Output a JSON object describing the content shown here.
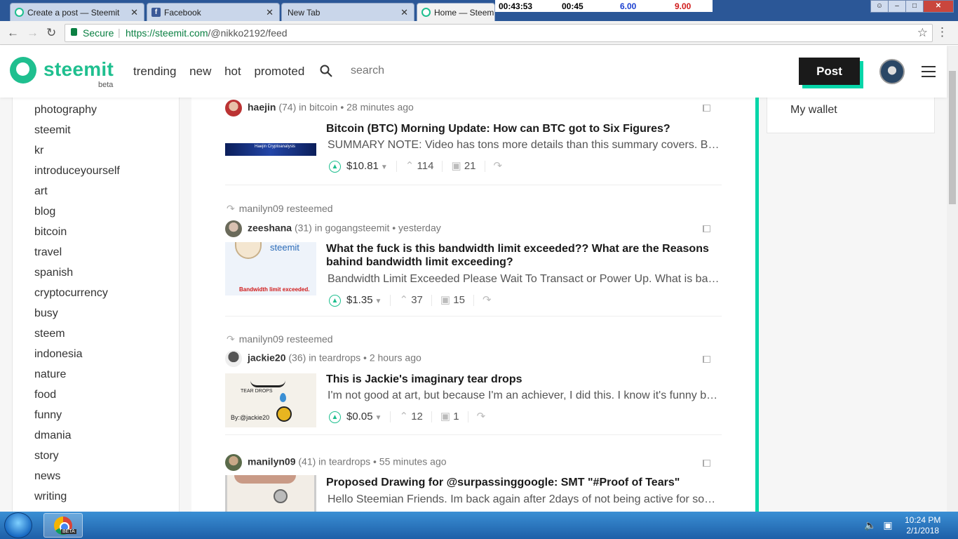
{
  "browser": {
    "tabs": [
      {
        "label": "Create a post — Steemit",
        "close": "✕"
      },
      {
        "label": "Facebook",
        "close": "✕"
      },
      {
        "label": "New Tab",
        "close": "✕"
      },
      {
        "label": "Home — Steem...",
        "close": ""
      }
    ],
    "ticker": {
      "time1": "00:43:53",
      "time2": "00:45",
      "val1": "6.00",
      "val2": "9.00"
    },
    "address": {
      "secure_label": "Secure",
      "url_host": "https://steemit.com",
      "url_path": "/@nikko2192/feed"
    }
  },
  "header": {
    "logo_text": "steemit",
    "logo_beta": "beta",
    "nav": [
      "trending",
      "new",
      "hot",
      "promoted"
    ],
    "search_placeholder": "search",
    "post_label": "Post"
  },
  "sidebar": {
    "tags": [
      "photography",
      "steemit",
      "kr",
      "introduceyourself",
      "art",
      "blog",
      "bitcoin",
      "travel",
      "spanish",
      "cryptocurrency",
      "busy",
      "steem",
      "indonesia",
      "nature",
      "food",
      "funny",
      "dmania",
      "story",
      "news",
      "writing"
    ]
  },
  "right": {
    "wallet": "My wallet"
  },
  "posts": [
    {
      "resteem": "",
      "author": "haejin",
      "rep": "(74)",
      "in": "in",
      "category": "bitcoin",
      "time": "• 28 minutes ago",
      "title": "Bitcoin (BTC) Morning Update: How can BTC got to Six Figures?",
      "summary": "SUMMARY NOTE: Video has tons more details than this summary covers. Bitcoin (BTC) Morning Update...",
      "payout": "$10.81",
      "votes": "114",
      "comments": "21",
      "thumb_caption": "Haejin Cryptoanalysis"
    },
    {
      "resteem": "manilyn09 resteemed",
      "author": "zeeshana",
      "rep": "(31)",
      "in": "in",
      "category": "gogangsteemit",
      "time": "• yesterday",
      "title": "What the fuck is this bandwidth limit exceeded?? What are the Reasons bahind bandwidth limit exceeding?",
      "summary": "Bandwidth Limit Exceeded Please Wait To Transact or Power Up. What is bandwidth limit exceeded...",
      "payout": "$1.35",
      "votes": "37",
      "comments": "15",
      "thumb_caption": "Bandwidth limit exceeded.",
      "thumb_logo": "steemit"
    },
    {
      "resteem": "manilyn09 resteemed",
      "author": "jackie20",
      "rep": "(36)",
      "in": "in",
      "category": "teardrops",
      "time": "• 2 hours ago",
      "title": "This is Jackie's imaginary tear drops",
      "summary": "I'm not good at art, but because I'm an achiever, I did this. I know it's funny but I tried my best...",
      "payout": "$0.05",
      "votes": "12",
      "comments": "1",
      "thumb_caption": "TEAR DROPS",
      "thumb_sign": "By:@jackie20"
    },
    {
      "resteem": "",
      "author": "manilyn09",
      "rep": "(41)",
      "in": "in",
      "category": "teardrops",
      "time": "• 55 minutes ago",
      "title": "Proposed Drawing for @surpassinggoogle: SMT \"#Proof of Tears\"",
      "summary": "Hello Steemian Friends. Im back again after 2days of not being active for some reasons...",
      "payout": "",
      "votes": "",
      "comments": ""
    }
  ],
  "taskbar": {
    "chrome_badge": "BETA",
    "time": "10:24 PM",
    "date": "2/1/2018"
  },
  "colors": {
    "brand": "#1fbf8f",
    "accent": "#06d6a9",
    "tabbar": "#2b5797"
  }
}
